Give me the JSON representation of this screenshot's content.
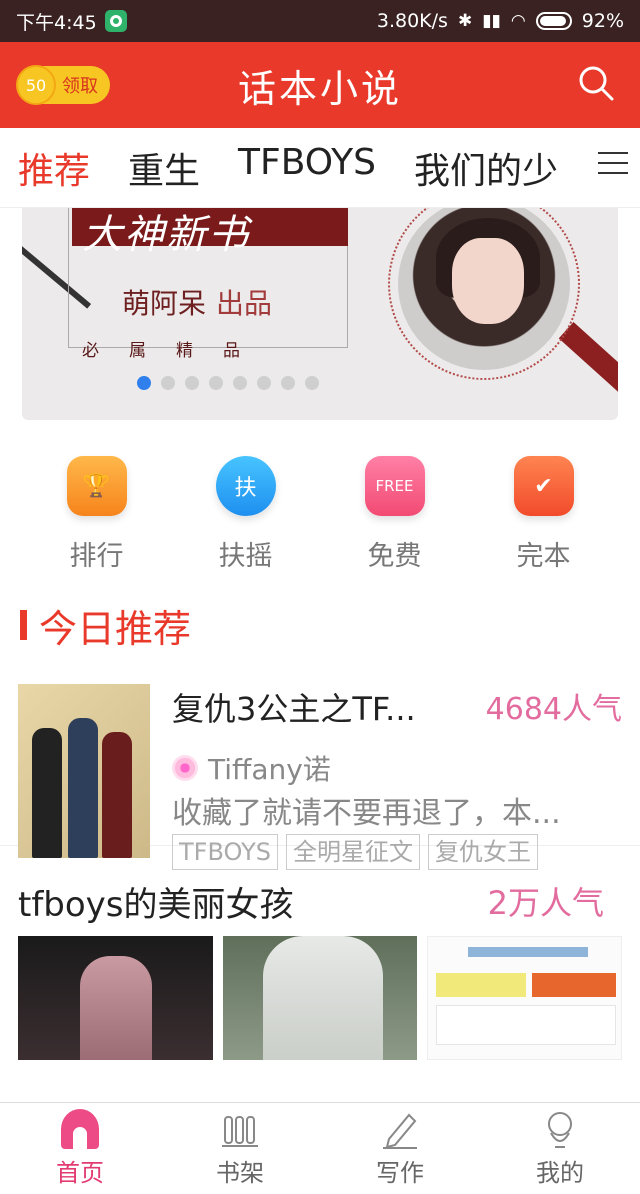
{
  "status_bar": {
    "time": "下午4:45",
    "speed": "3.80K/s",
    "battery": "92%",
    "battery_fraction": 0.92
  },
  "header": {
    "coin_value": "50",
    "coin_label": "领取",
    "title": "话本小说"
  },
  "tabs": [
    {
      "label": "推荐"
    },
    {
      "label": "重生"
    },
    {
      "label": "TFBOYS"
    },
    {
      "label": "我们的少"
    }
  ],
  "banner": {
    "headline": "大神新书",
    "author": "萌阿呆",
    "author_suffix": "出品",
    "motto": "必属精品",
    "dot_count": 8,
    "active_dot": 0
  },
  "quick_entries": [
    {
      "label": "排行",
      "icon": "trophy-icon",
      "glyph": "🏆"
    },
    {
      "label": "扶摇",
      "icon": "fuyao-icon",
      "glyph": "扶"
    },
    {
      "label": "免费",
      "icon": "free-icon",
      "glyph": "FREE"
    },
    {
      "label": "完本",
      "icon": "check-icon",
      "glyph": "✔"
    }
  ],
  "section": {
    "title": "今日推荐"
  },
  "featured_book": {
    "title": "复仇3公主之TF...",
    "popularity": "4684人气",
    "author": "Tiffany诺",
    "description": "收藏了就请不要再退了，本...",
    "tags": [
      "TFBOYS",
      "全明星征文",
      "复仇女王"
    ]
  },
  "list": {
    "title": "tfboys的美丽女孩",
    "popularity": "2万人气"
  },
  "bottom_nav": [
    {
      "label": "首页",
      "icon": "home-icon",
      "active": true
    },
    {
      "label": "书架",
      "icon": "bookshelf-icon",
      "active": false
    },
    {
      "label": "写作",
      "icon": "pen-icon",
      "active": false
    },
    {
      "label": "我的",
      "icon": "profile-icon",
      "active": false
    }
  ],
  "colors": {
    "brand_red": "#e8392b",
    "popularity_pink": "#e36c9f",
    "active_dot_blue": "#2f80ed"
  }
}
